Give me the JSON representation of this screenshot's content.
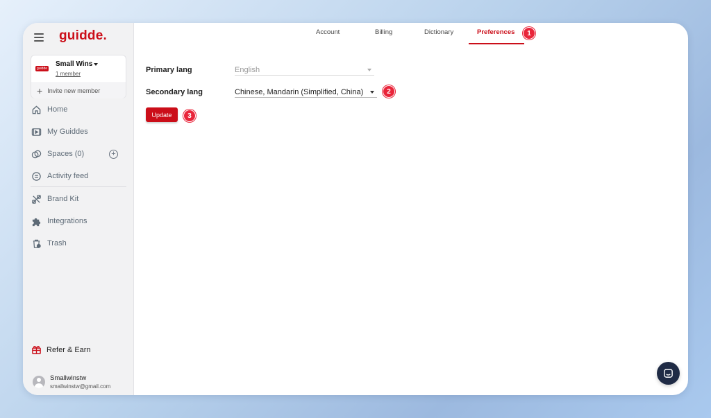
{
  "brand": {
    "logo": "guidde.",
    "accent": "#cb0e19",
    "badge_color": "#e9253a"
  },
  "workspace": {
    "badge": "guidde",
    "name": "Small Wins",
    "members": "1 member",
    "invite": "Invite new member"
  },
  "sidebar": {
    "items": [
      {
        "label": "Home",
        "icon": "home-icon"
      },
      {
        "label": "My Guiddes",
        "icon": "video-icon"
      },
      {
        "label": "Spaces (0)",
        "icon": "spaces-icon"
      },
      {
        "label": "Activity feed",
        "icon": "activity-icon"
      },
      {
        "label": "Brand Kit",
        "icon": "brand-kit-icon"
      },
      {
        "label": "Integrations",
        "icon": "puzzle-icon"
      },
      {
        "label": "Trash",
        "icon": "trash-icon"
      }
    ],
    "refer": "Refer & Earn"
  },
  "user": {
    "name": "Smallwinstw",
    "email": "smallwinstw@gmail.com"
  },
  "tabs": [
    {
      "label": "Account"
    },
    {
      "label": "Billing"
    },
    {
      "label": "Dictionary"
    },
    {
      "label": "Preferences",
      "active": true
    }
  ],
  "form": {
    "primary_label": "Primary lang",
    "primary_value": "English",
    "secondary_label": "Secondary lang",
    "secondary_value": "Chinese, Mandarin (Simplified, China)",
    "update_label": "Update"
  },
  "step_badges": [
    "1",
    "2",
    "3"
  ]
}
